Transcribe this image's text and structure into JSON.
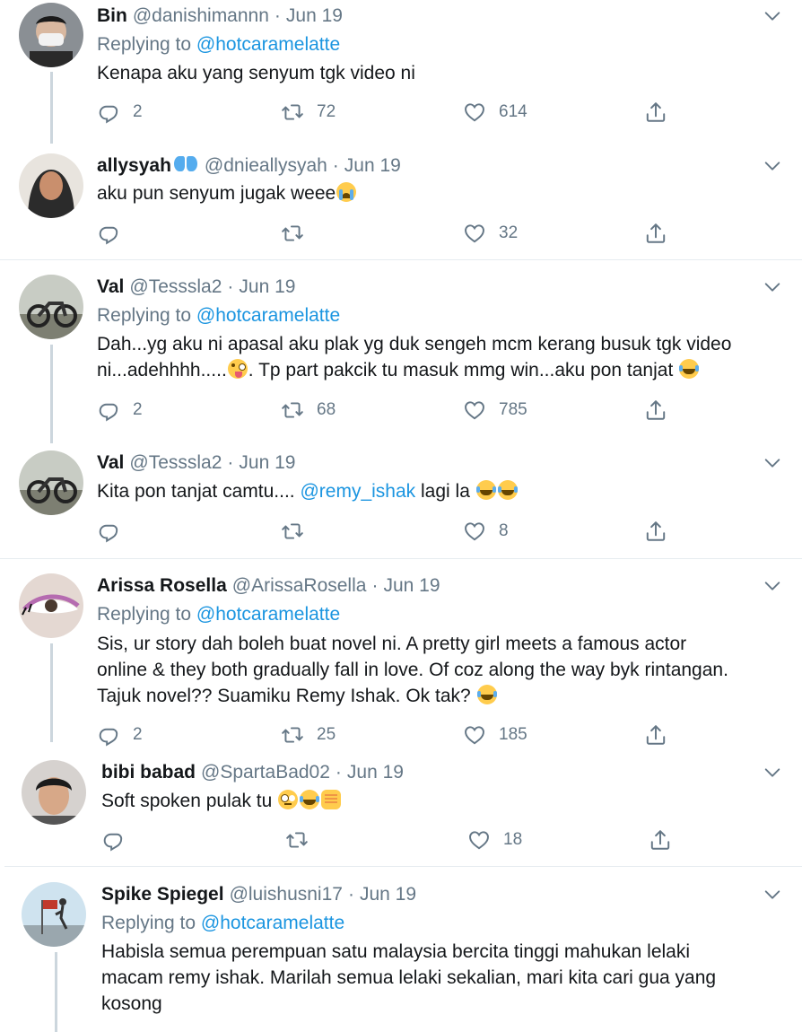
{
  "tweets": [
    {
      "name": "Bin",
      "handle": "@danishimannn",
      "date": "Jun 19",
      "replying_prefix": "Replying to",
      "replying_to": "@hotcaramelatte",
      "text": "Kenapa aku yang senyum tgk video ni",
      "replies": "2",
      "retweets": "72",
      "likes": "614"
    },
    {
      "name": "allysyah",
      "handle": "@dnieallysyah",
      "date": "Jun 19",
      "text": "aku pun senyum jugak weee",
      "replies": "",
      "retweets": "",
      "likes": "32"
    },
    {
      "name": "Val",
      "handle": "@Tesssla2",
      "date": "Jun 19",
      "replying_prefix": "Replying to",
      "replying_to": "@hotcaramelatte",
      "text_line1": "Dah...yg aku ni apasal aku plak yg duk sengeh mcm kerang busuk tgk video",
      "text_line2a": "ni...adehhhh.....",
      "text_line2b": ". Tp part pakcik tu masuk mmg win...aku pon tanjat",
      "replies": "2",
      "retweets": "68",
      "likes": "785"
    },
    {
      "name": "Val",
      "handle": "@Tesssla2",
      "date": "Jun 19",
      "text_a": "Kita pon tanjat camtu....",
      "mention": "@remy_ishak",
      "text_b": "lagi la",
      "replies": "",
      "retweets": "",
      "likes": "8"
    },
    {
      "name": "Arissa Rosella",
      "handle": "@ArissaRosella",
      "date": "Jun 19",
      "replying_prefix": "Replying to",
      "replying_to": "@hotcaramelatte",
      "text_line1": "Sis, ur story dah boleh buat novel ni. A pretty girl meets a famous actor",
      "text_line2": "online & they both gradually fall in love. Of coz along the way byk rintangan.",
      "text_line3": "Tajuk novel?? Suamiku Remy Ishak. Ok tak?",
      "replies": "2",
      "retweets": "25",
      "likes": "185"
    },
    {
      "name": "bibi babad",
      "handle": "@SpartaBad02",
      "date": "Jun 19",
      "text": "Soft spoken pulak tu",
      "replies": "",
      "retweets": "",
      "likes": "18"
    },
    {
      "name": "Spike Spiegel",
      "handle": "@luishusni17",
      "date": "Jun 19",
      "replying_prefix": "Replying to",
      "replying_to": "@hotcaramelatte",
      "text_line1": "Habisla semua perempuan satu malaysia bercita tinggi mahukan lelaki",
      "text_line2": "macam remy ishak. Marilah semua lelaki sekalian, mari kita cari gua yang",
      "text_line3": "kosong"
    }
  ],
  "icons": [
    "reply-icon",
    "retweet-icon",
    "like-icon",
    "share-icon",
    "chevron-down-icon"
  ],
  "colors": {
    "link": "#1b95e0",
    "muted": "#657786",
    "text": "#14171a",
    "divider": "#e6ecf0"
  }
}
